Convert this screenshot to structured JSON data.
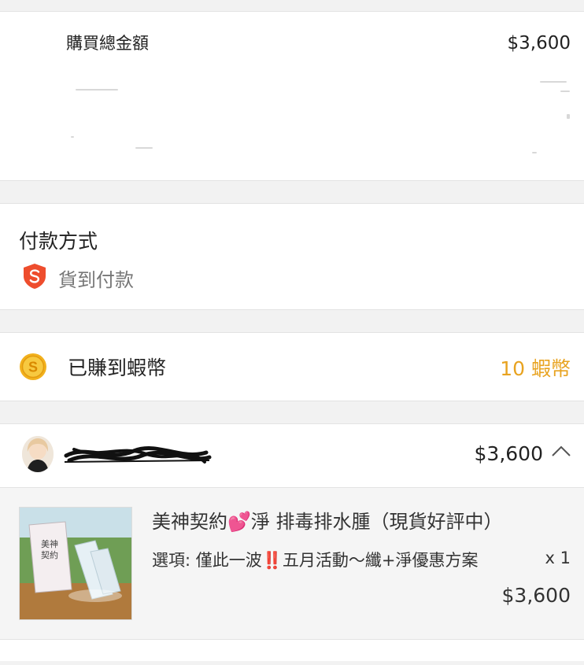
{
  "order_total": {
    "label": "購買總金額",
    "value": "$3,600"
  },
  "payment": {
    "title": "付款方式",
    "method": "貨到付款",
    "icon": "shopee-s-shield-icon",
    "icon_color": "#ee4d2d"
  },
  "coins": {
    "label": "已賺到蝦幣",
    "value": "10 蝦幣",
    "icon": "coin-icon",
    "value_color": "#e8a320"
  },
  "shop": {
    "total": "$3,600",
    "collapse_icon": "chevron-up-icon"
  },
  "product": {
    "title": "美神契約💕淨 排毒排水腫（現貨好評中）",
    "option": "選項: 僅此一波‼️五月活動～纖+淨優惠方案",
    "quantity": "x 1",
    "price": "$3,600",
    "thumbnail_text": "美神\n契約"
  }
}
